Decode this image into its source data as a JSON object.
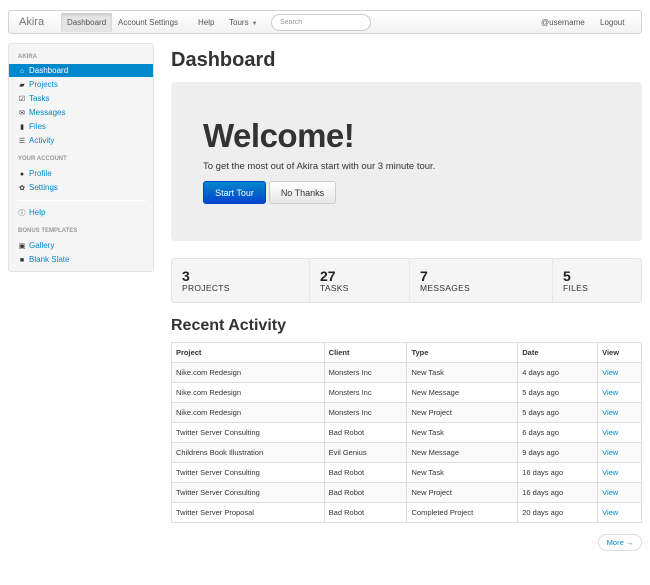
{
  "navbar": {
    "brand": "Akira",
    "items": [
      {
        "label": "Dashboard"
      },
      {
        "label": "Account Settings"
      },
      {
        "label": "Help"
      },
      {
        "label": "Tours"
      }
    ],
    "search_placeholder": "Search",
    "username": "@username",
    "logout": "Logout"
  },
  "sidebar": {
    "header_main": "Akira",
    "main_items": [
      {
        "label": "Dashboard",
        "icon": "home-icon"
      },
      {
        "label": "Projects",
        "icon": "folder-icon"
      },
      {
        "label": "Tasks",
        "icon": "check-icon"
      },
      {
        "label": "Messages",
        "icon": "envelope-icon"
      },
      {
        "label": "Files",
        "icon": "file-icon"
      },
      {
        "label": "Activity",
        "icon": "list-icon"
      }
    ],
    "header_account": "Your Account",
    "account_items": [
      {
        "label": "Profile",
        "icon": "user-icon"
      },
      {
        "label": "Settings",
        "icon": "gear-icon"
      }
    ],
    "help": {
      "label": "Help",
      "icon": "info-icon"
    },
    "header_bonus": "Bonus Templates",
    "bonus_items": [
      {
        "label": "Gallery",
        "icon": "picture-icon"
      },
      {
        "label": "Blank Slate",
        "icon": "stop-icon"
      }
    ]
  },
  "main": {
    "title": "Dashboard",
    "hero": {
      "title": "Welcome!",
      "text": "To get the most out of Akira start with our 3 minute tour.",
      "primary_button": "Start Tour",
      "secondary_button": "No Thanks"
    },
    "stats": [
      {
        "value": "3",
        "label": "PROJECTS"
      },
      {
        "value": "27",
        "label": "TASKS"
      },
      {
        "value": "7",
        "label": "MESSAGES"
      },
      {
        "value": "5",
        "label": "FILES"
      }
    ],
    "activity_title": "Recent Activity",
    "table": {
      "headers": [
        "Project",
        "Client",
        "Type",
        "Date",
        "View"
      ],
      "rows": [
        [
          "Nike.com Redesign",
          "Monsters Inc",
          "New Task",
          "4 days ago",
          "View"
        ],
        [
          "Nike.com Redesign",
          "Monsters Inc",
          "New Message",
          "5 days ago",
          "View"
        ],
        [
          "Nike.com Redesign",
          "Monsters Inc",
          "New Project",
          "5 days ago",
          "View"
        ],
        [
          "Twitter Server Consulting",
          "Bad Robot",
          "New Task",
          "6 days ago",
          "View"
        ],
        [
          "Childrens Book Illustration",
          "Evil Genius",
          "New Message",
          "9 days ago",
          "View"
        ],
        [
          "Twitter Server Consulting",
          "Bad Robot",
          "New Task",
          "16 days ago",
          "View"
        ],
        [
          "Twitter Server Consulting",
          "Bad Robot",
          "New Project",
          "16 days ago",
          "View"
        ],
        [
          "Twitter Server Proposal",
          "Bad Robot",
          "Completed Project",
          "20 days ago",
          "View"
        ]
      ]
    },
    "more_button": "More →"
  },
  "colors": {
    "accent": "#0088cc",
    "primary_button": "#0044cc",
    "hero_bg": "#eeeeee"
  }
}
